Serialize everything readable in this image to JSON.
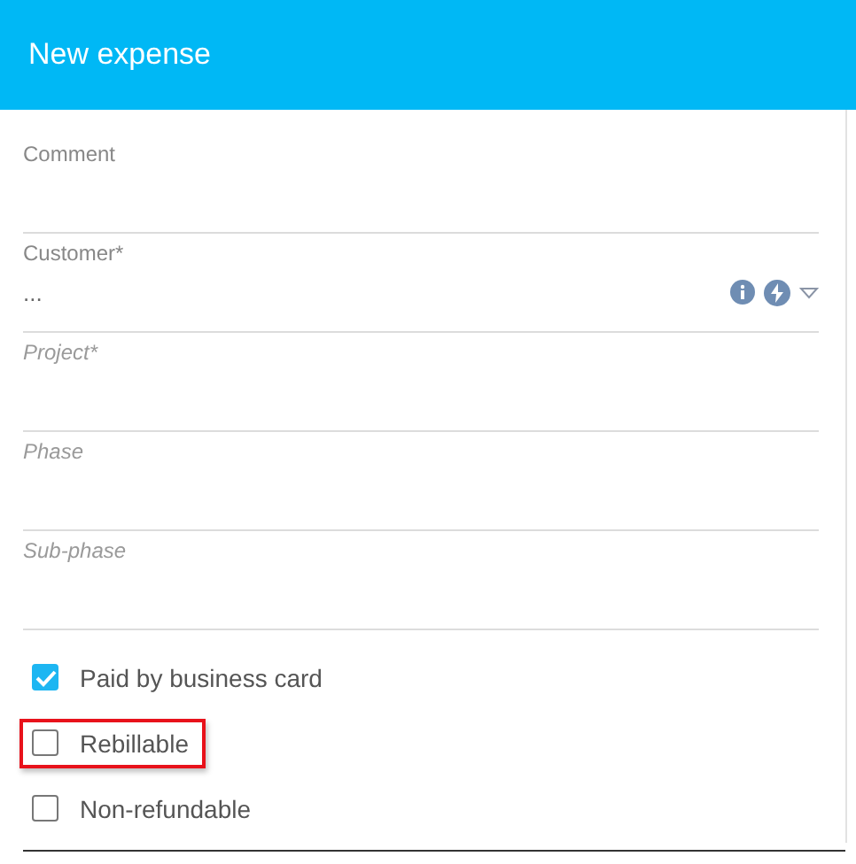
{
  "header": {
    "title": "New expense"
  },
  "fields": [
    {
      "label": "Comment",
      "disabled": false
    },
    {
      "label": "Customer*",
      "disabled": false,
      "value": "...",
      "kind": "lookup"
    },
    {
      "label": "Project*",
      "disabled": true
    },
    {
      "label": "Phase",
      "disabled": true
    },
    {
      "label": "Sub-phase",
      "disabled": true
    }
  ],
  "checkboxes": [
    {
      "label": "Paid by business card",
      "checked": true,
      "highlighted": false
    },
    {
      "label": "Rebillable",
      "checked": false,
      "highlighted": true
    },
    {
      "label": "Non-refundable",
      "checked": false,
      "highlighted": false
    }
  ]
}
